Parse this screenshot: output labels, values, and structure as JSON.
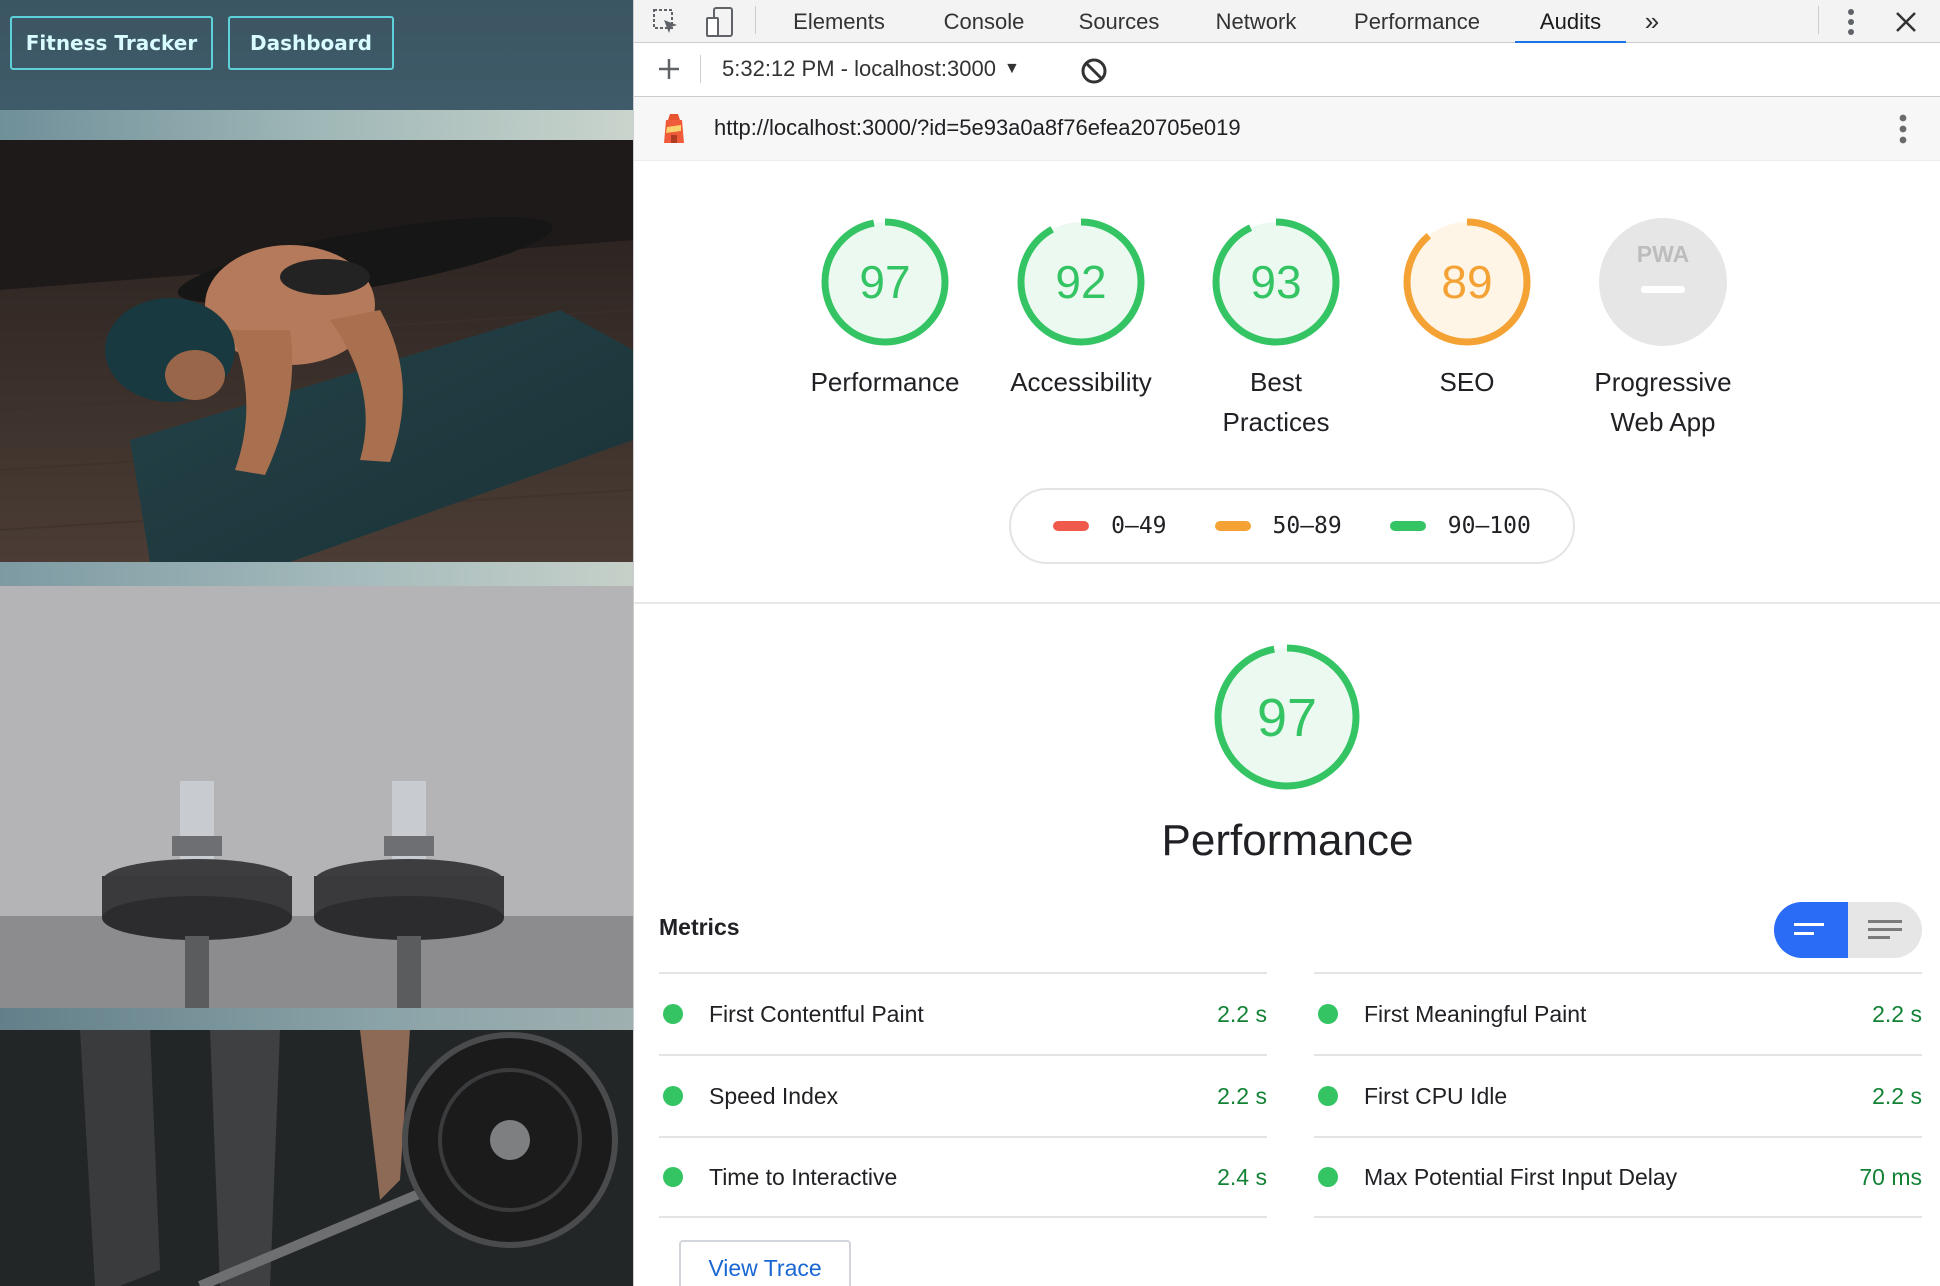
{
  "app": {
    "nav": {
      "brand_label": "Fitness Tracker",
      "dashboard_label": "Dashboard"
    },
    "photos": [
      "pushup-workout-photo",
      "dumbbells-photo",
      "barbell-deadlift-photo"
    ]
  },
  "devtools": {
    "tabs": [
      "Elements",
      "Console",
      "Sources",
      "Network",
      "Performance",
      "Audits"
    ],
    "active_tab": "Audits",
    "report_select": "5:32:12 PM - localhost:3000",
    "audit_url": "http://localhost:3000/?id=5e93a0a8f76efea20705e019",
    "scores": [
      {
        "label": "Performance",
        "score": "97",
        "fraction": 0.97,
        "color": "#34c464"
      },
      {
        "label": "Accessibility",
        "score": "92",
        "fraction": 0.92,
        "color": "#34c464"
      },
      {
        "label": "Best Practices",
        "score": "93",
        "fraction": 0.93,
        "color": "#34c464"
      },
      {
        "label": "SEO",
        "score": "89",
        "fraction": 0.89,
        "color": "#f4a233"
      },
      {
        "label": "Progressive Web App",
        "score": "PWA",
        "color": "#bdbdbd"
      }
    ],
    "legend": [
      {
        "range": "0–49",
        "color": "#ef5a4c"
      },
      {
        "range": "50–89",
        "color": "#f4a233"
      },
      {
        "range": "90–100",
        "color": "#34c464"
      }
    ],
    "performance_section": {
      "score": "97",
      "fraction": 0.97,
      "title": "Performance"
    },
    "metrics_heading": "Metrics",
    "metrics_left": [
      {
        "name": "First Contentful Paint",
        "value": "2.2 s"
      },
      {
        "name": "Speed Index",
        "value": "2.2 s"
      },
      {
        "name": "Time to Interactive",
        "value": "2.4 s"
      }
    ],
    "metrics_right": [
      {
        "name": "First Meaningful Paint",
        "value": "2.2 s"
      },
      {
        "name": "First CPU Idle",
        "value": "2.2 s"
      },
      {
        "name": "Max Potential First Input Delay",
        "value": "70 ms"
      }
    ],
    "view_trace_label": "View Trace",
    "colors": {
      "pass": "#34c464",
      "average": "#f4a233",
      "fail": "#ef5a4c",
      "accent": "#1a73e8"
    }
  }
}
